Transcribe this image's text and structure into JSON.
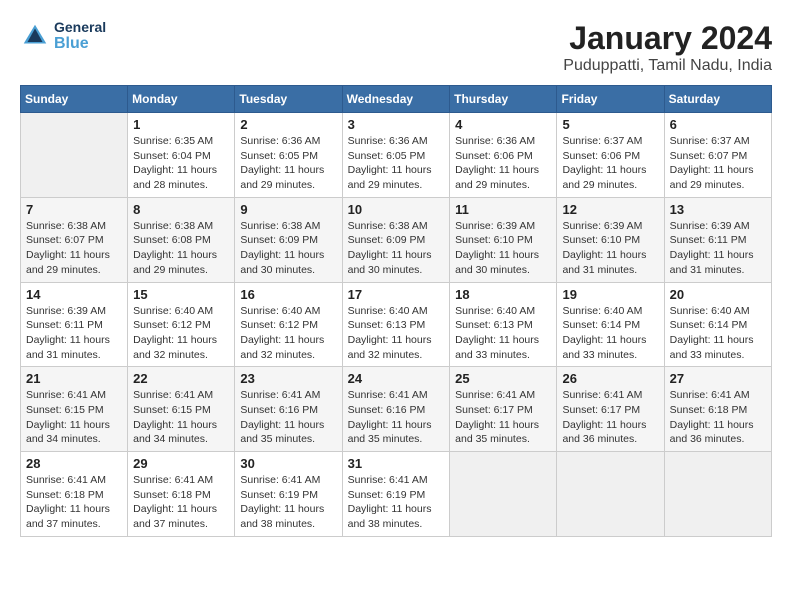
{
  "header": {
    "logo": {
      "general": "General",
      "blue": "Blue"
    },
    "title": "January 2024",
    "subtitle": "Puduppatti, Tamil Nadu, India"
  },
  "calendar": {
    "days_of_week": [
      "Sunday",
      "Monday",
      "Tuesday",
      "Wednesday",
      "Thursday",
      "Friday",
      "Saturday"
    ],
    "weeks": [
      [
        {
          "day": "",
          "empty": true
        },
        {
          "day": "1",
          "sunrise": "Sunrise: 6:35 AM",
          "sunset": "Sunset: 6:04 PM",
          "daylight": "Daylight: 11 hours and 28 minutes."
        },
        {
          "day": "2",
          "sunrise": "Sunrise: 6:36 AM",
          "sunset": "Sunset: 6:05 PM",
          "daylight": "Daylight: 11 hours and 29 minutes."
        },
        {
          "day": "3",
          "sunrise": "Sunrise: 6:36 AM",
          "sunset": "Sunset: 6:05 PM",
          "daylight": "Daylight: 11 hours and 29 minutes."
        },
        {
          "day": "4",
          "sunrise": "Sunrise: 6:36 AM",
          "sunset": "Sunset: 6:06 PM",
          "daylight": "Daylight: 11 hours and 29 minutes."
        },
        {
          "day": "5",
          "sunrise": "Sunrise: 6:37 AM",
          "sunset": "Sunset: 6:06 PM",
          "daylight": "Daylight: 11 hours and 29 minutes."
        },
        {
          "day": "6",
          "sunrise": "Sunrise: 6:37 AM",
          "sunset": "Sunset: 6:07 PM",
          "daylight": "Daylight: 11 hours and 29 minutes."
        }
      ],
      [
        {
          "day": "7",
          "sunrise": "Sunrise: 6:38 AM",
          "sunset": "Sunset: 6:07 PM",
          "daylight": "Daylight: 11 hours and 29 minutes."
        },
        {
          "day": "8",
          "sunrise": "Sunrise: 6:38 AM",
          "sunset": "Sunset: 6:08 PM",
          "daylight": "Daylight: 11 hours and 29 minutes."
        },
        {
          "day": "9",
          "sunrise": "Sunrise: 6:38 AM",
          "sunset": "Sunset: 6:09 PM",
          "daylight": "Daylight: 11 hours and 30 minutes."
        },
        {
          "day": "10",
          "sunrise": "Sunrise: 6:38 AM",
          "sunset": "Sunset: 6:09 PM",
          "daylight": "Daylight: 11 hours and 30 minutes."
        },
        {
          "day": "11",
          "sunrise": "Sunrise: 6:39 AM",
          "sunset": "Sunset: 6:10 PM",
          "daylight": "Daylight: 11 hours and 30 minutes."
        },
        {
          "day": "12",
          "sunrise": "Sunrise: 6:39 AM",
          "sunset": "Sunset: 6:10 PM",
          "daylight": "Daylight: 11 hours and 31 minutes."
        },
        {
          "day": "13",
          "sunrise": "Sunrise: 6:39 AM",
          "sunset": "Sunset: 6:11 PM",
          "daylight": "Daylight: 11 hours and 31 minutes."
        }
      ],
      [
        {
          "day": "14",
          "sunrise": "Sunrise: 6:39 AM",
          "sunset": "Sunset: 6:11 PM",
          "daylight": "Daylight: 11 hours and 31 minutes."
        },
        {
          "day": "15",
          "sunrise": "Sunrise: 6:40 AM",
          "sunset": "Sunset: 6:12 PM",
          "daylight": "Daylight: 11 hours and 32 minutes."
        },
        {
          "day": "16",
          "sunrise": "Sunrise: 6:40 AM",
          "sunset": "Sunset: 6:12 PM",
          "daylight": "Daylight: 11 hours and 32 minutes."
        },
        {
          "day": "17",
          "sunrise": "Sunrise: 6:40 AM",
          "sunset": "Sunset: 6:13 PM",
          "daylight": "Daylight: 11 hours and 32 minutes."
        },
        {
          "day": "18",
          "sunrise": "Sunrise: 6:40 AM",
          "sunset": "Sunset: 6:13 PM",
          "daylight": "Daylight: 11 hours and 33 minutes."
        },
        {
          "day": "19",
          "sunrise": "Sunrise: 6:40 AM",
          "sunset": "Sunset: 6:14 PM",
          "daylight": "Daylight: 11 hours and 33 minutes."
        },
        {
          "day": "20",
          "sunrise": "Sunrise: 6:40 AM",
          "sunset": "Sunset: 6:14 PM",
          "daylight": "Daylight: 11 hours and 33 minutes."
        }
      ],
      [
        {
          "day": "21",
          "sunrise": "Sunrise: 6:41 AM",
          "sunset": "Sunset: 6:15 PM",
          "daylight": "Daylight: 11 hours and 34 minutes."
        },
        {
          "day": "22",
          "sunrise": "Sunrise: 6:41 AM",
          "sunset": "Sunset: 6:15 PM",
          "daylight": "Daylight: 11 hours and 34 minutes."
        },
        {
          "day": "23",
          "sunrise": "Sunrise: 6:41 AM",
          "sunset": "Sunset: 6:16 PM",
          "daylight": "Daylight: 11 hours and 35 minutes."
        },
        {
          "day": "24",
          "sunrise": "Sunrise: 6:41 AM",
          "sunset": "Sunset: 6:16 PM",
          "daylight": "Daylight: 11 hours and 35 minutes."
        },
        {
          "day": "25",
          "sunrise": "Sunrise: 6:41 AM",
          "sunset": "Sunset: 6:17 PM",
          "daylight": "Daylight: 11 hours and 35 minutes."
        },
        {
          "day": "26",
          "sunrise": "Sunrise: 6:41 AM",
          "sunset": "Sunset: 6:17 PM",
          "daylight": "Daylight: 11 hours and 36 minutes."
        },
        {
          "day": "27",
          "sunrise": "Sunrise: 6:41 AM",
          "sunset": "Sunset: 6:18 PM",
          "daylight": "Daylight: 11 hours and 36 minutes."
        }
      ],
      [
        {
          "day": "28",
          "sunrise": "Sunrise: 6:41 AM",
          "sunset": "Sunset: 6:18 PM",
          "daylight": "Daylight: 11 hours and 37 minutes."
        },
        {
          "day": "29",
          "sunrise": "Sunrise: 6:41 AM",
          "sunset": "Sunset: 6:18 PM",
          "daylight": "Daylight: 11 hours and 37 minutes."
        },
        {
          "day": "30",
          "sunrise": "Sunrise: 6:41 AM",
          "sunset": "Sunset: 6:19 PM",
          "daylight": "Daylight: 11 hours and 38 minutes."
        },
        {
          "day": "31",
          "sunrise": "Sunrise: 6:41 AM",
          "sunset": "Sunset: 6:19 PM",
          "daylight": "Daylight: 11 hours and 38 minutes."
        },
        {
          "day": "",
          "empty": true
        },
        {
          "day": "",
          "empty": true
        },
        {
          "day": "",
          "empty": true
        }
      ]
    ]
  }
}
